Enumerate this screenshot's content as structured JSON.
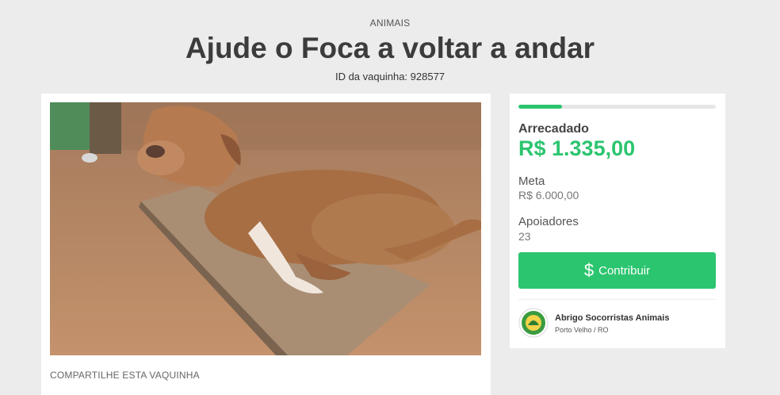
{
  "header": {
    "category": "ANIMAIS",
    "title": "Ajude o Foca a voltar a andar",
    "campaign_id": "ID da vaquinha: 928577"
  },
  "main": {
    "image_description_icon": "dog-photo",
    "share_label": "COMPARTILHE ESTA VAQUINHA"
  },
  "sidebar": {
    "progress_fraction": 0.22,
    "raised_label": "Arrecadado",
    "raised_value": "R$ 1.335,00",
    "goal_label": "Meta",
    "goal_value": "R$ 6.000,00",
    "supporters_label": "Apoiadores",
    "supporters_value": "23",
    "contribute_button": "Contribuir",
    "organizer_name": "Abrigo Socorristas Animais",
    "organizer_location": "Porto Velho / RO"
  },
  "colors": {
    "accent": "#2cc56f",
    "background": "#ececec"
  }
}
